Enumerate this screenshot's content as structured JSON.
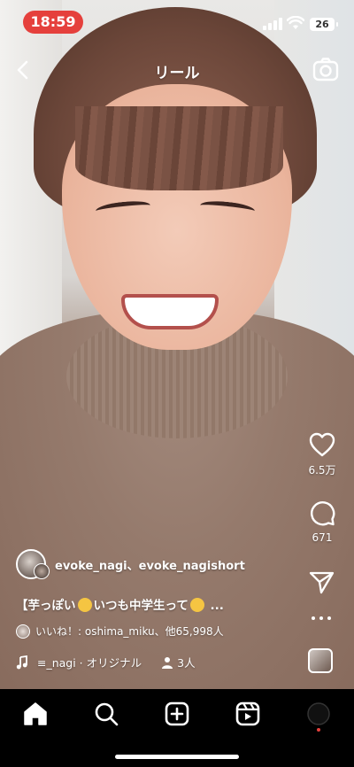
{
  "status_bar": {
    "time": "18:59",
    "battery": "26"
  },
  "header": {
    "title": "リール",
    "back_icon": "chevron-left-icon",
    "camera_icon": "camera-icon"
  },
  "actions": {
    "likes": "6.5万",
    "comments": "671"
  },
  "post": {
    "usernames": "evoke_nagi、evoke_nagishort",
    "caption_parts": [
      "【芋っぽい",
      "いつも中学生って",
      " ..."
    ],
    "liked_by": "いいね！: oshima_miku、他65,998人",
    "audio": "≡_nagi · オリジナル",
    "people_count": "3人"
  },
  "tabs": [
    "home",
    "search",
    "create",
    "reels",
    "profile"
  ],
  "colors": {
    "accent_red": "#e5403c",
    "tabbar_bg": "#000000"
  }
}
